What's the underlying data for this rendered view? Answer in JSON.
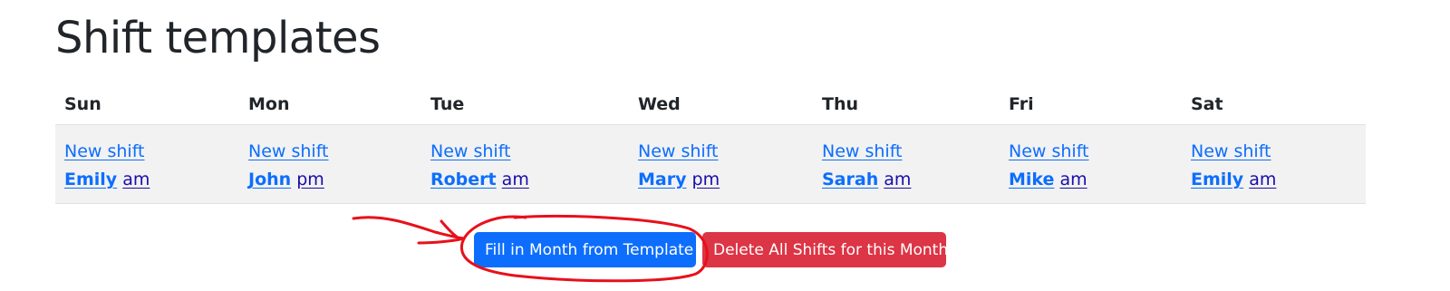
{
  "page": {
    "title": "Shift templates"
  },
  "table": {
    "days": [
      "Sun",
      "Mon",
      "Tue",
      "Wed",
      "Thu",
      "Fri",
      "Sat"
    ],
    "cells": [
      {
        "new_shift": "New shift",
        "person": "Emily",
        "period": "am"
      },
      {
        "new_shift": "New shift",
        "person": "John",
        "period": "pm"
      },
      {
        "new_shift": "New shift",
        "person": "Robert",
        "period": "am"
      },
      {
        "new_shift": "New shift",
        "person": "Mary",
        "period": "pm"
      },
      {
        "new_shift": "New shift",
        "person": "Sarah",
        "period": "am"
      },
      {
        "new_shift": "New shift",
        "person": "Mike",
        "period": "am"
      },
      {
        "new_shift": "New shift",
        "person": "Emily",
        "period": "am"
      }
    ]
  },
  "actions": {
    "fill_label": "Fill in Month from Template",
    "delete_label": "Delete All Shifts for this Month"
  },
  "colors": {
    "primary": "#0d6efd",
    "danger": "#dc3545",
    "annotation": "#e8101a"
  }
}
